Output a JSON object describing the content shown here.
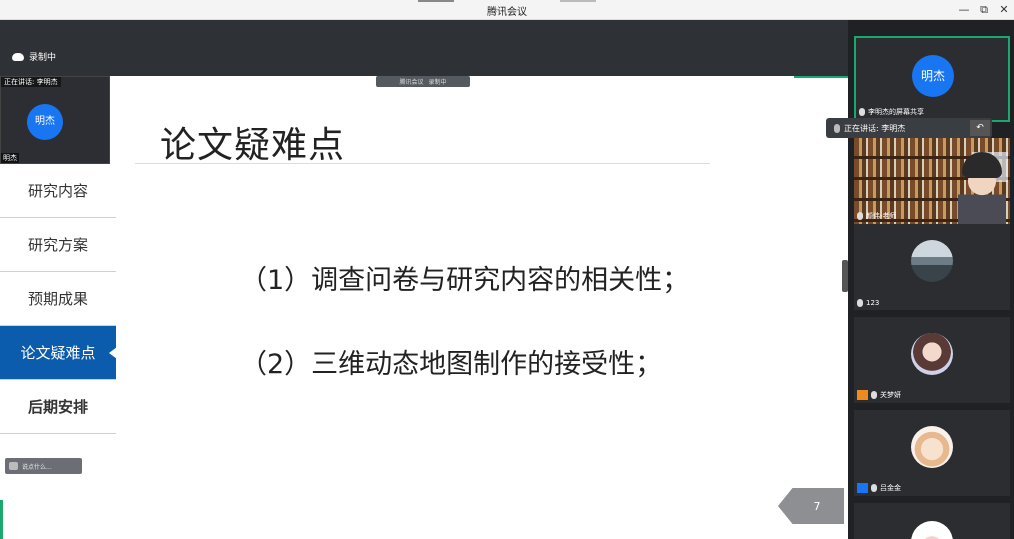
{
  "window": {
    "title": "腾讯会议",
    "minimize": "—",
    "restore": "⧉",
    "close": "✕"
  },
  "recording": {
    "label": "录制中"
  },
  "floating_toolbar": {
    "app": "腾讯会议",
    "rec": "录制中"
  },
  "mini_tile": {
    "speaking": "正在讲话: 李明杰",
    "avatar": "明杰",
    "name": "明杰"
  },
  "sidenav": {
    "items": [
      {
        "label": "研究内容"
      },
      {
        "label": "研究方案"
      },
      {
        "label": "预期成果"
      },
      {
        "label": "论文疑难点",
        "active": true
      },
      {
        "label": "后期安排"
      }
    ]
  },
  "slide": {
    "title": "论文疑难点",
    "points": [
      "（1）调查问卷与研究内容的相关性；",
      "（2）三维动态地图制作的接受性；"
    ],
    "page": "7"
  },
  "chat": {
    "placeholder": "说点什么..."
  },
  "speaking_pill": {
    "label": "正在讲话: 李明杰",
    "undo": "↶"
  },
  "participants": [
    {
      "name": "李明杰的屏幕共享",
      "avatar": "明杰",
      "type": "avatar"
    },
    {
      "name": "颜伟-老师",
      "type": "camera"
    },
    {
      "name": "123",
      "type": "lake"
    },
    {
      "name": "关梦妍",
      "type": "girl"
    },
    {
      "name": "吕金金",
      "type": "cake"
    }
  ],
  "colors": {
    "accent": "#1976f2",
    "active_nav": "#0b5cad",
    "green": "#1aa86e"
  }
}
